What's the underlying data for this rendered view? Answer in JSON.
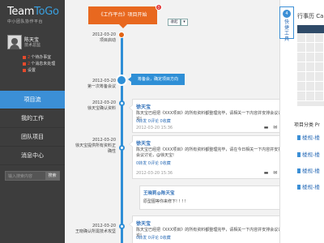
{
  "brand": {
    "logo_team": "Team",
    "logo_togo": "ToGo",
    "tagline": "中小团队协作平台"
  },
  "user": {
    "name": "陈天宝",
    "role": "技术总监"
  },
  "stats": [
    {
      "count": "2",
      "label": "个待办事宜"
    },
    {
      "count": "2",
      "label": "个消息未处理"
    },
    {
      "count": "",
      "label": "设置"
    }
  ],
  "nav": [
    {
      "label": "项目流",
      "active": true
    },
    {
      "label": "我的工作",
      "active": false
    },
    {
      "label": "团队项目",
      "active": false
    },
    {
      "label": "消息中心",
      "active": false
    }
  ],
  "search": {
    "placeholder": "输入搜索内容",
    "button": "搜索"
  },
  "timeline": {
    "start_banner": "《工作平台》项目开始",
    "badge": "0",
    "collapse_label": "收起",
    "collapse_toggle": "▾",
    "events": [
      {
        "date": "2012-03-20",
        "desc": "项目启动"
      },
      {
        "date": "2012-03-20",
        "desc": "第一次筹备会议"
      },
      {
        "date": "2012-03-20",
        "desc": "徐天宝确认资料"
      },
      {
        "date": "2012-03-20",
        "desc": "徐天宝提供所有资料正确性"
      },
      {
        "date": "2012-03-20",
        "desc": "王晓确认所需技术攻坚"
      }
    ],
    "callout": "筹备会，确定项目方向",
    "cards": [
      {
        "name": "徐天宝",
        "body": "陈天宝已经把《XXX项目》的所有资料都整理完毕，请相关一下内容并安排会议讨论!",
        "links": "0转发  0评论  0收藏",
        "time": "2012-03-20 15:36"
      },
      {
        "name": "徐天宝",
        "body": "陈天宝已经把《XXX项目》的所有资料都整理完毕，请在今日相关一下内容并安排会议讨论，@徐天宝!",
        "links": "0转发  0评论  0收藏",
        "time": "2012-03-20 15:36"
      },
      {
        "name": "徐天宝",
        "body": "陈天宝已经把《XXX项目》的所有资料都整理完毕，请相关一下内容并安排会议讨论!",
        "links": "0转发  0评论  0收藏",
        "time": ""
      }
    ],
    "reply": {
      "name": "王晓莉@陈天宝",
      "body": "原型图等你来修下! ! ! !"
    },
    "actions": "▬ ✉ ⤢"
  },
  "right_panel": {
    "tab_badge": "4",
    "tab_label": "快捷工具",
    "title": "行事历 Cale",
    "category": "项目分类 Pr",
    "items": [
      "楼规-楼",
      "楼规-楼",
      "楼规-楼",
      "楼规-楼"
    ]
  },
  "colors": {
    "sidebar": "#3d3d3d",
    "accent": "#2f8fd6",
    "orange": "#e8681f",
    "badge": "#e02424"
  }
}
